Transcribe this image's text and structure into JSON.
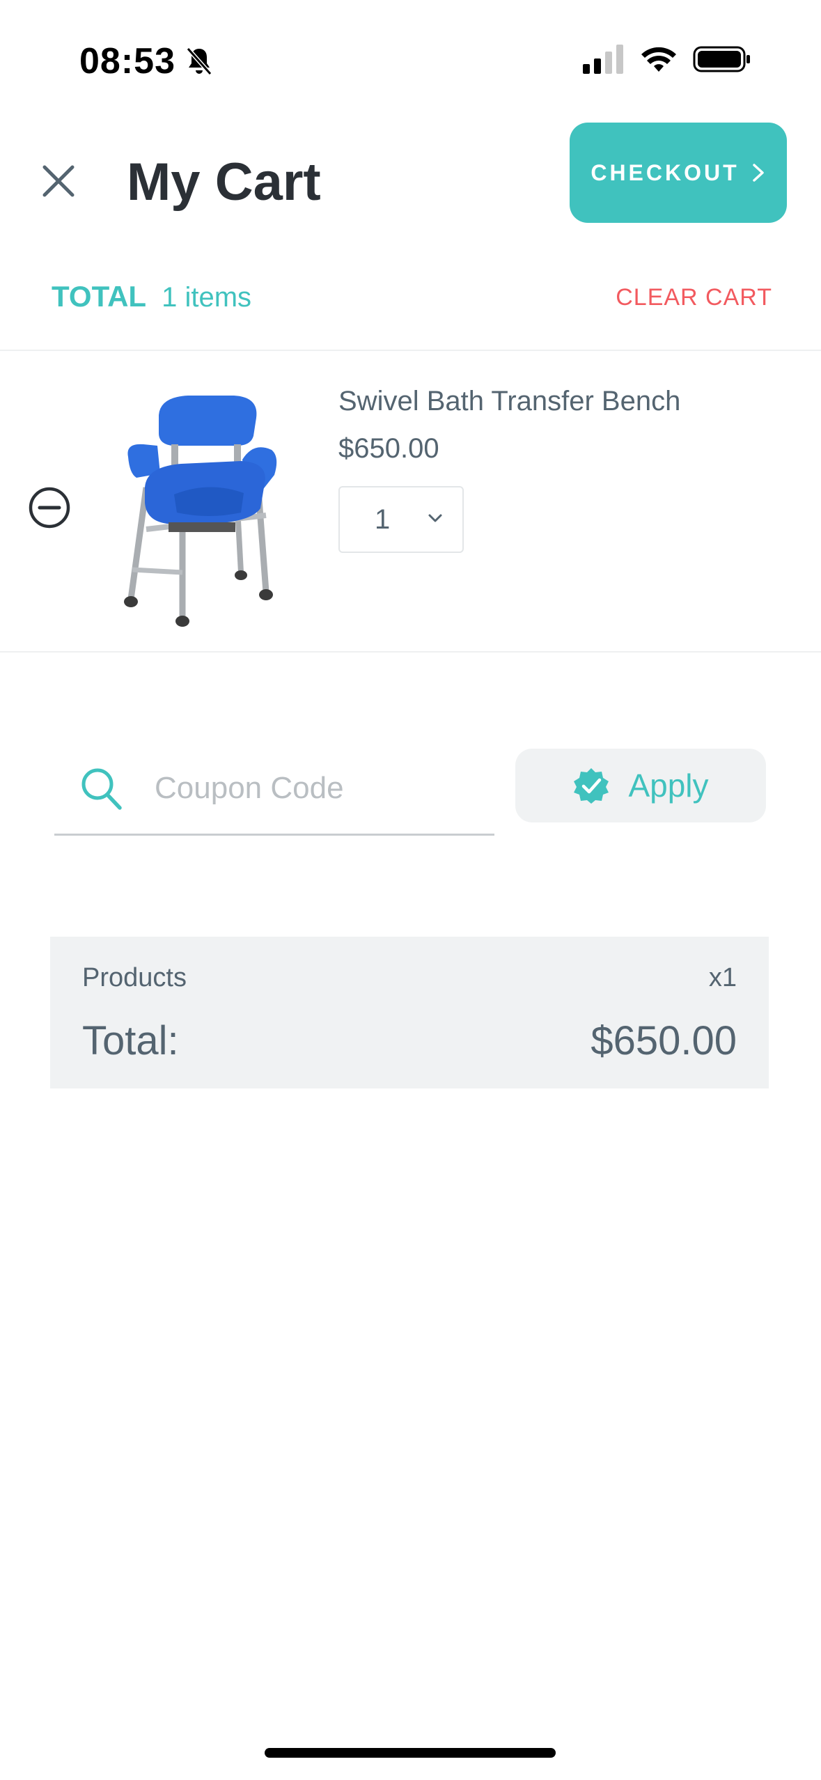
{
  "status_bar": {
    "time": "08:53"
  },
  "header": {
    "title": "My Cart",
    "checkout_label": "CHECKOUT"
  },
  "summary_line": {
    "total_label": "TOTAL",
    "items_text": "1 items",
    "clear_label": "CLEAR CART"
  },
  "cart_items": [
    {
      "name": "Swivel Bath Transfer Bench",
      "price": "$650.00",
      "quantity": "1"
    }
  ],
  "coupon": {
    "placeholder": "Coupon Code",
    "value": "",
    "apply_label": "Apply"
  },
  "order_summary": {
    "products_label": "Products",
    "products_count": "x1",
    "total_label": "Total:",
    "total_value": "$650.00"
  },
  "colors": {
    "accent": "#40c2be",
    "danger": "#f25a5f",
    "text": "#546470",
    "title": "#2b3036",
    "panel": "#f0f2f3"
  }
}
